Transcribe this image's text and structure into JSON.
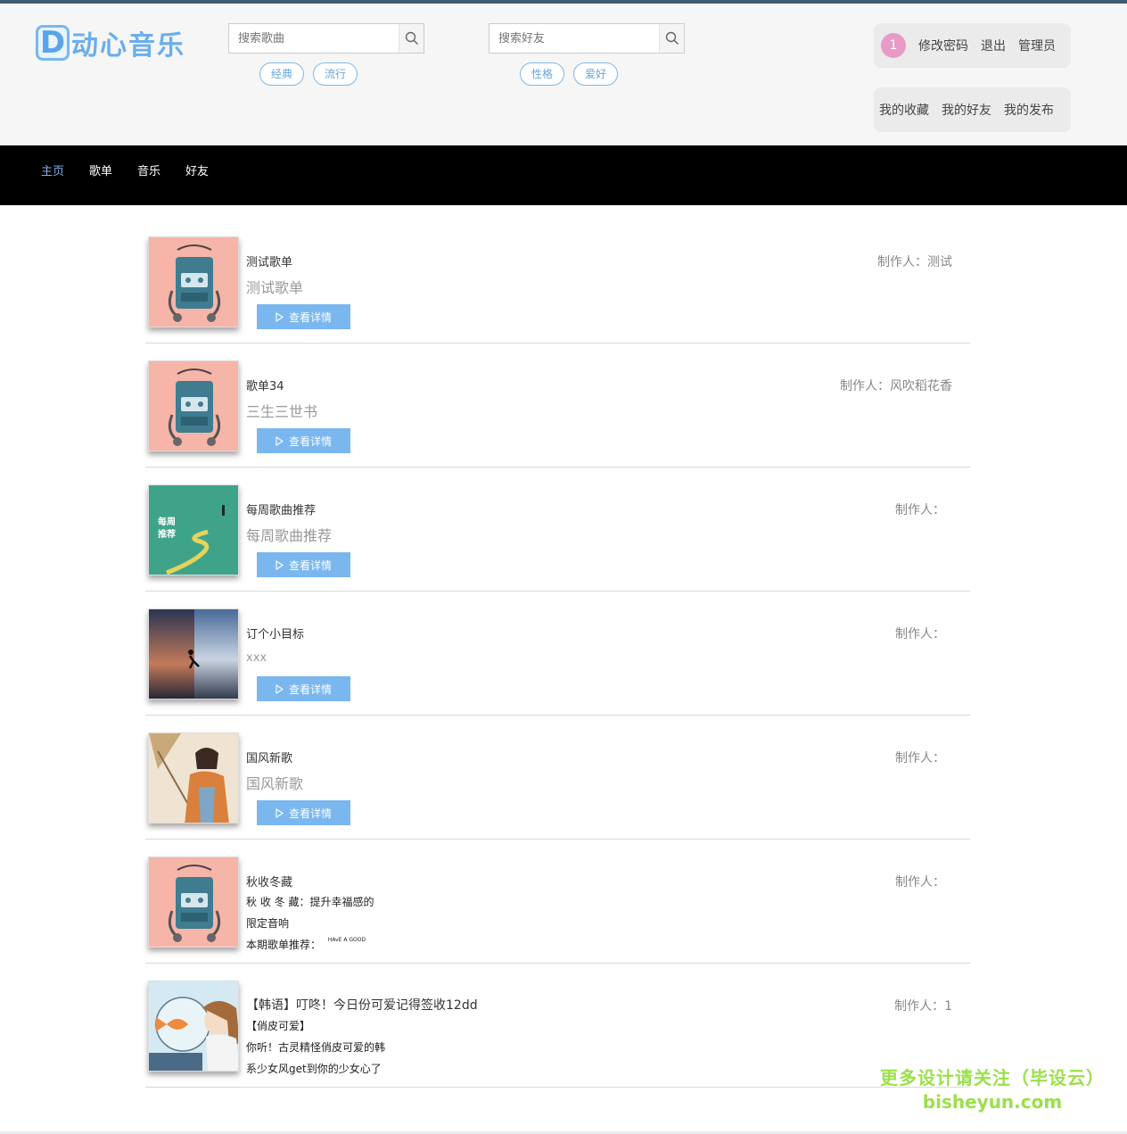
{
  "header": {
    "logo_letter": "D",
    "logo_text": "动心音乐",
    "song_search": {
      "placeholder": "搜索歌曲",
      "tags": [
        "经典",
        "流行"
      ]
    },
    "friend_search": {
      "placeholder": "搜索好友",
      "tags": [
        "性格",
        "爱好"
      ]
    },
    "user": {
      "badge": "1",
      "change_password": "修改密码",
      "logout": "退出",
      "admin": "管理员"
    },
    "mine": {
      "favorites": "我的收藏",
      "friends": "我的好友",
      "posts": "我的发布"
    }
  },
  "nav": {
    "items": [
      "主页",
      "歌单",
      "音乐",
      "好友"
    ],
    "active": "主页"
  },
  "playlists": [
    {
      "title": "测试歌单",
      "subtitle": "测试歌单",
      "button": "查看详情",
      "maker": "制作人：测试",
      "cover": "walkman-pink"
    },
    {
      "title": "歌单34",
      "subtitle": "三生三世书",
      "button": "查看详情",
      "maker": "制作人：风吹稻花香",
      "cover": "walkman-pink"
    },
    {
      "title": "每周歌曲推荐",
      "subtitle": "每周歌曲推荐",
      "button": "查看详情",
      "maker": "制作人：",
      "cover": "weekly-green",
      "cover_text": [
        "每周",
        "推荐"
      ]
    },
    {
      "title": "订个小目标",
      "subtitle": "xxx",
      "button": "查看详情",
      "maker": "制作人：",
      "cover": "runner-sky"
    },
    {
      "title": "国风新歌",
      "subtitle": "国风新歌",
      "button": "查看详情",
      "maker": "制作人：",
      "cover": "guofeng-girl"
    },
    {
      "title": "秋收冬藏",
      "maker": "制作人：",
      "cover": "walkman-pink",
      "desc": [
        "秋 收 冬 藏：提升幸福感的",
        "限定音响",
        "本期歌单推荐：",
        "HAvE  A  GOOD"
      ]
    },
    {
      "title": "【韩语】叮咚！今日份可爱记得签收12dd",
      "maker": "制作人：1",
      "cover": "goldfish-girl",
      "desc": [
        "【俏皮可爱】",
        "你听！古灵精怪俏皮可爱的韩",
        "系少女风get到你的少女心了"
      ]
    }
  ],
  "watermark": {
    "line1": "更多设计请关注（毕设云）",
    "line2": "bisheyun.com"
  }
}
